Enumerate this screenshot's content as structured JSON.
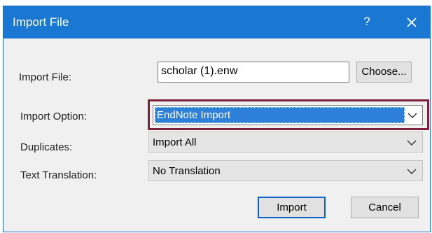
{
  "window": {
    "title": "Import File",
    "help_label": "?"
  },
  "fields": {
    "import_file": {
      "label": "Import File:",
      "value": "scholar (1).enw",
      "choose_label": "Choose..."
    },
    "import_option": {
      "label": "Import Option:",
      "selected": "EndNote Import"
    },
    "duplicates": {
      "label": "Duplicates:",
      "selected": "Import All"
    },
    "text_translation": {
      "label": "Text Translation:",
      "selected": "No Translation"
    }
  },
  "buttons": {
    "import_label": "Import",
    "cancel_label": "Cancel"
  },
  "colors": {
    "titlebar": "#1a78d2",
    "highlight_frame": "#7e1f3b",
    "selection": "#2e7fd8"
  },
  "icons": {
    "close": "close-icon",
    "dropdown": "chevron-down-icon"
  }
}
